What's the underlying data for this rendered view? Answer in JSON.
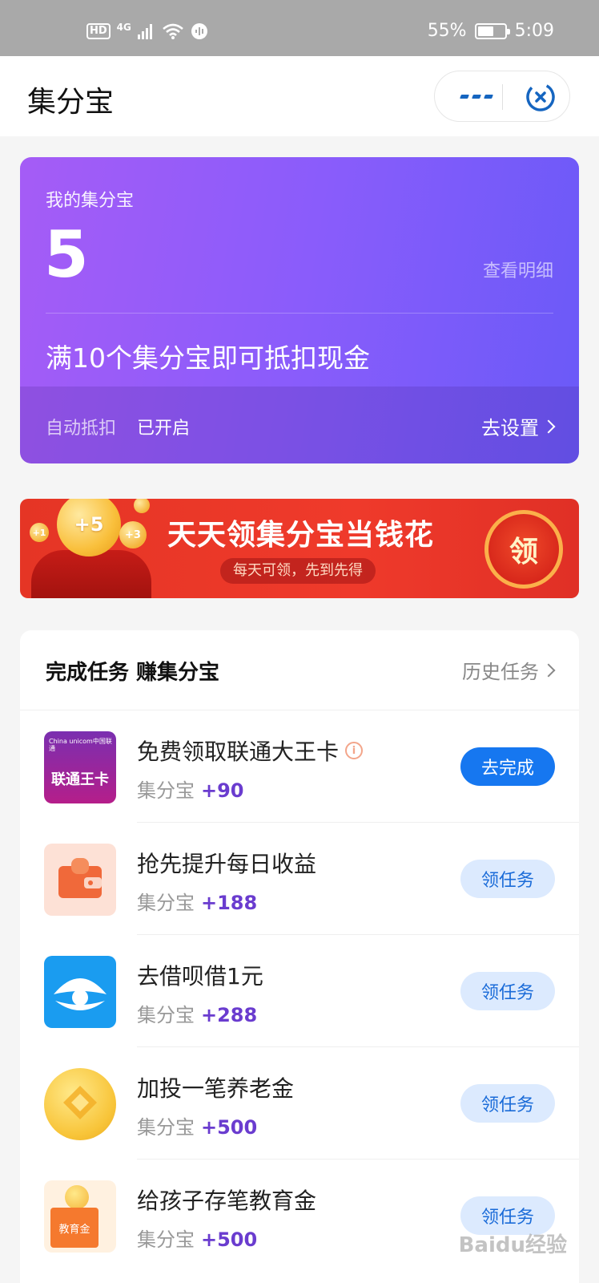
{
  "status_bar": {
    "hd": "HD",
    "network": "4G",
    "battery": "55%",
    "battery_level": 0.55,
    "time": "5:09"
  },
  "nav": {
    "title": "集分宝"
  },
  "card": {
    "label": "我的集分宝",
    "value": "5",
    "detail_link": "查看明细",
    "promo": "满10个集分宝即可抵扣现金",
    "auto_label": "自动抵扣",
    "auto_status": "已开启",
    "setting_link": "去设置"
  },
  "banner": {
    "coin_big": "+5",
    "coin_a": "+1",
    "coin_b": "+3",
    "title": "天天领集分宝当钱花",
    "subtitle": "每天可领，先到先得",
    "button": "领"
  },
  "tasks": {
    "title": "完成任务 赚集分宝",
    "history": "历史任务",
    "items": [
      {
        "name": "免费领取联通大王卡",
        "reward_label": "集分宝",
        "reward": "+90",
        "button": "去完成",
        "icon": "unicom-card-icon",
        "icon_text_top": "China unicom中国联通",
        "icon_text": "联通王卡"
      },
      {
        "name": "抢先提升每日收益",
        "reward_label": "集分宝",
        "reward": "+188",
        "button": "领任务",
        "icon": "wallet-icon"
      },
      {
        "name": "去借呗借1元",
        "reward_label": "集分宝",
        "reward": "+288",
        "button": "领任务",
        "icon": "jiebei-icon"
      },
      {
        "name": "加投一笔养老金",
        "reward_label": "集分宝",
        "reward": "+500",
        "button": "领任务",
        "icon": "gold-coin-icon"
      },
      {
        "name": "给孩子存笔教育金",
        "reward_label": "集分宝",
        "reward": "+500",
        "button": "领任务",
        "icon": "education-fund-icon",
        "icon_text": "教育金"
      }
    ]
  },
  "watermark": "Baidu经验"
}
